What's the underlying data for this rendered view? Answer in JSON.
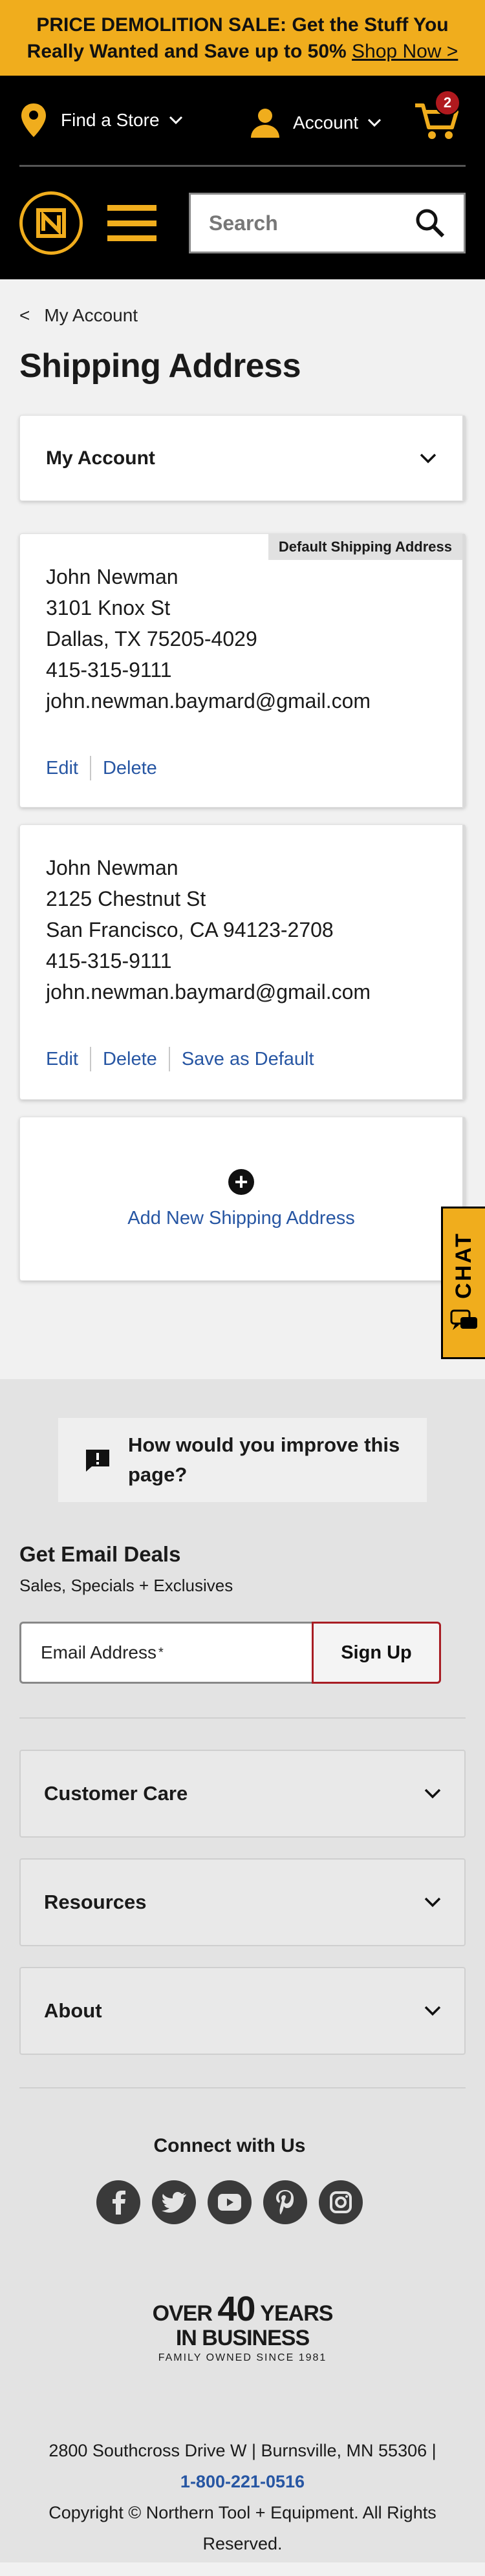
{
  "promo": {
    "text": "PRICE DEMOLITION SALE: Get the Stuff You Really Wanted and Save up to 50%",
    "link": "Shop Now >"
  },
  "header": {
    "find_store": "Find a Store",
    "account": "Account",
    "cart_count": "2",
    "search_placeholder": "Search"
  },
  "breadcrumb": {
    "back": "My Account"
  },
  "page_title": "Shipping Address",
  "account_menu": {
    "label": "My Account"
  },
  "addresses": [
    {
      "tag": "Default Shipping Address",
      "name": "John Newman",
      "street": "3101 Knox St",
      "city": "Dallas, TX 75205-4029",
      "phone": "415-315-9111",
      "email": "john.newman.baymard@gmail.com",
      "edit": "Edit",
      "delete": "Delete"
    },
    {
      "name": "John Newman",
      "street": "2125 Chestnut St",
      "city": "San Francisco, CA 94123-2708",
      "phone": "415-315-9111",
      "email": "john.newman.baymard@gmail.com",
      "edit": "Edit",
      "delete": "Delete",
      "default": "Save as Default"
    }
  ],
  "add_new": "Add New Shipping Address",
  "chat": "CHAT",
  "footer": {
    "improve": "How would you improve this page?",
    "deals_heading": "Get Email Deals",
    "deals_sub": "Sales, Specials + Exclusives",
    "email_label": "Email Address",
    "email_req": "*",
    "signup": "Sign Up",
    "sections": [
      "Customer Care",
      "Resources",
      "About"
    ],
    "connect": "Connect with Us",
    "years_over": "OVER ",
    "years_num": "40",
    "years_word": " YEARS",
    "years_in_business": "IN BUSINESS",
    "years_family": "FAMILY OWNED SINCE 1981",
    "address": "2800 Southcross Drive W | Burnsville, MN 55306 |",
    "phone": "1-800-221-0516",
    "copyright": "Copyright © Northern Tool + Equipment. All Rights Reserved."
  },
  "colors": {
    "brand_yellow": "#f0ad1d",
    "link_blue": "#2756a3",
    "badge_red": "#b0191e",
    "header_black": "#000000"
  },
  "icons": [
    "location-pin-icon",
    "chevron-down-icon",
    "person-icon",
    "cart-icon",
    "logo-icon",
    "hamburger-icon",
    "search-icon",
    "plus-icon",
    "chat-icon",
    "feedback-icon",
    "facebook-icon",
    "twitter-icon",
    "youtube-icon",
    "pinterest-icon",
    "instagram-icon"
  ]
}
